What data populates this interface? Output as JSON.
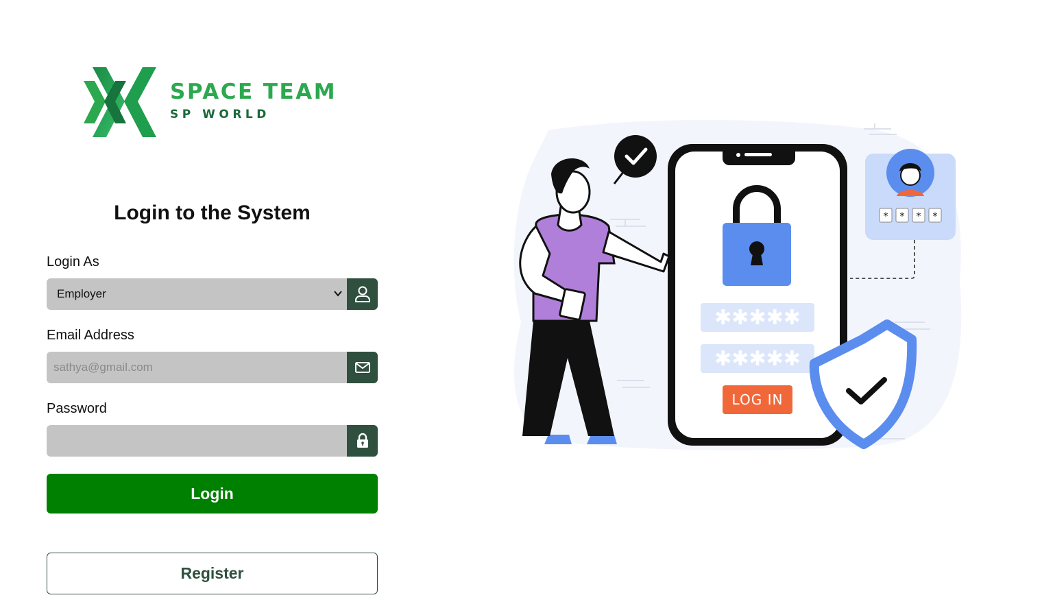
{
  "brand": {
    "name": "SPACE TEAM",
    "tagline": "SP WORLD",
    "colors": {
      "primary_green": "#2ca84f",
      "dark_green": "#1a6a3a"
    }
  },
  "form": {
    "title": "Login to the System",
    "login_as": {
      "label": "Login As",
      "selected": "Employer",
      "icon": "user-icon"
    },
    "email": {
      "label": "Email Address",
      "placeholder": "sathya@gmail.com",
      "value": "",
      "icon": "mail-icon"
    },
    "password": {
      "label": "Password",
      "value": "",
      "icon": "lock-icon"
    },
    "login_button": "Login",
    "register_button": "Register"
  },
  "illustration": {
    "screen_button_text": "LOG IN",
    "icon": "security-login-illustration"
  },
  "colors": {
    "input_bg": "#c4c4c4",
    "addon_bg": "#2f4f3f",
    "login_button_bg": "#008000",
    "accent_blue": "#5b8def",
    "accent_orange": "#f0683a",
    "accent_purple": "#b07fd9"
  }
}
